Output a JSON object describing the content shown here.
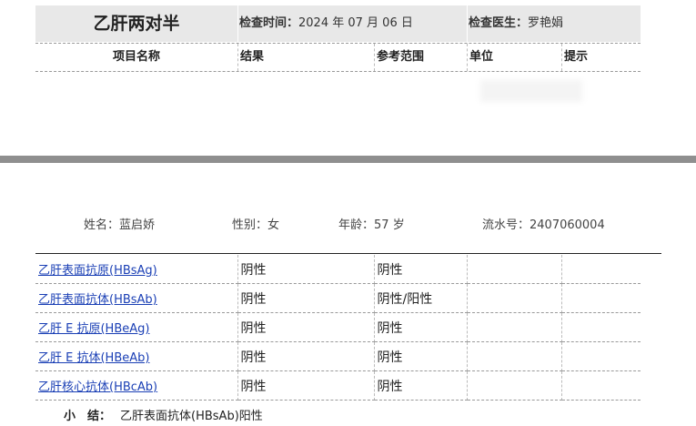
{
  "report": {
    "title": "乙肝两对半",
    "exam_time_label": "检查时间：",
    "exam_time": "2024 年 07 月 06 日",
    "doctor_label": "检查医生：",
    "doctor": "罗艳娟"
  },
  "columns": [
    "项目名称",
    "结果",
    "参考范围",
    "单位",
    "提示"
  ],
  "patient": {
    "name_label": "姓名：",
    "name": "蓝启娇",
    "sex_label": "性别：",
    "sex": "女",
    "age_label": "年龄：",
    "age": "57 岁",
    "serial_label": "流水号：",
    "serial": "2407060004"
  },
  "rows": [
    {
      "item": "乙肝表面抗原(HBsAg)",
      "result": "阴性",
      "reference": "阴性",
      "unit": "",
      "hint": ""
    },
    {
      "item": "乙肝表面抗体(HBsAb)",
      "result": "阴性",
      "reference": "阴性/阳性",
      "unit": "",
      "hint": ""
    },
    {
      "item": "乙肝 E 抗原(HBeAg)",
      "result": "阴性",
      "reference": "阴性",
      "unit": "",
      "hint": ""
    },
    {
      "item": "乙肝 E 抗体(HBeAb)",
      "result": "阴性",
      "reference": "阴性",
      "unit": "",
      "hint": ""
    },
    {
      "item": "乙肝核心抗体(HBcAb)",
      "result": "阴性",
      "reference": "阴性",
      "unit": "",
      "hint": ""
    }
  ],
  "summary": {
    "label": "小　结：",
    "text": "乙肝表面抗体(HBsAb)阳性"
  }
}
